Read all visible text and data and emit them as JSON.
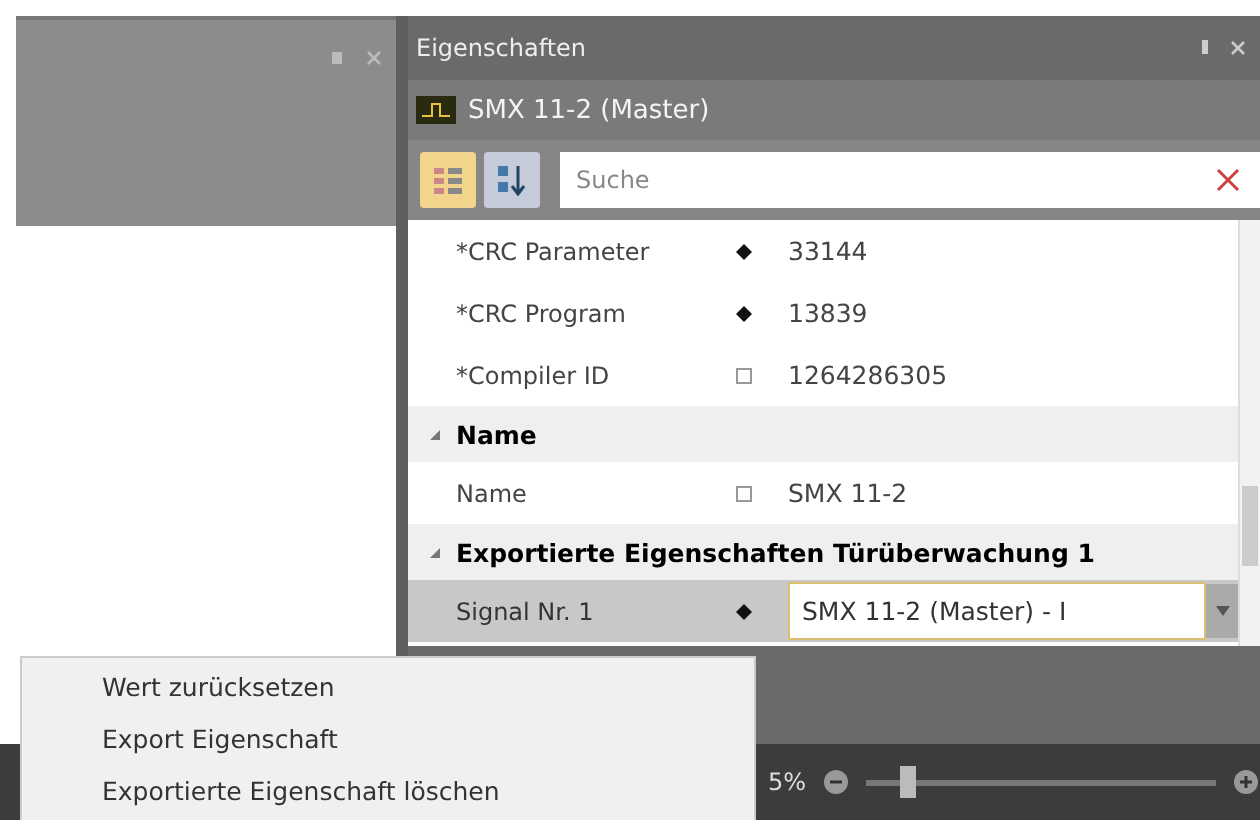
{
  "properties_panel": {
    "title": "Eigenschaften",
    "object": "SMX 11-2 (Master)",
    "toolbar": [
      {
        "kind": "categorized",
        "selected": true
      },
      {
        "kind": "alphabetical",
        "selected": false
      }
    ],
    "search": {
      "placeholder": "Suche"
    },
    "groups": [
      {
        "rows": [
          {
            "name": "*CRC Parameter",
            "kind": "filled",
            "value": "33144",
            "selected": false
          },
          {
            "name": "*CRC Program",
            "kind": "filled",
            "value": "13839",
            "selected": false
          },
          {
            "name": "*Compiler ID",
            "kind": "empty",
            "value": "1264286305",
            "selected": false
          }
        ]
      },
      {
        "label": "Name",
        "expanded": true,
        "rows": [
          {
            "name": "Name",
            "kind": "empty",
            "value": "SMX 11-2",
            "selected": false
          }
        ]
      },
      {
        "label": "Exportierte Eigenschaften Türüberwachung 1",
        "expanded": true,
        "rows": [
          {
            "name": "Signal Nr. 1",
            "kind": "filled",
            "value": "SMX 11-2 (Master) - I",
            "selected": true
          }
        ]
      }
    ]
  },
  "status_bar": {
    "zoom": "5%",
    "level": 0.1
  },
  "context_menu": {
    "items": [
      "Wert zurücksetzen",
      "Export Eigenschaft",
      "Exportierte Eigenschaft löschen"
    ]
  }
}
